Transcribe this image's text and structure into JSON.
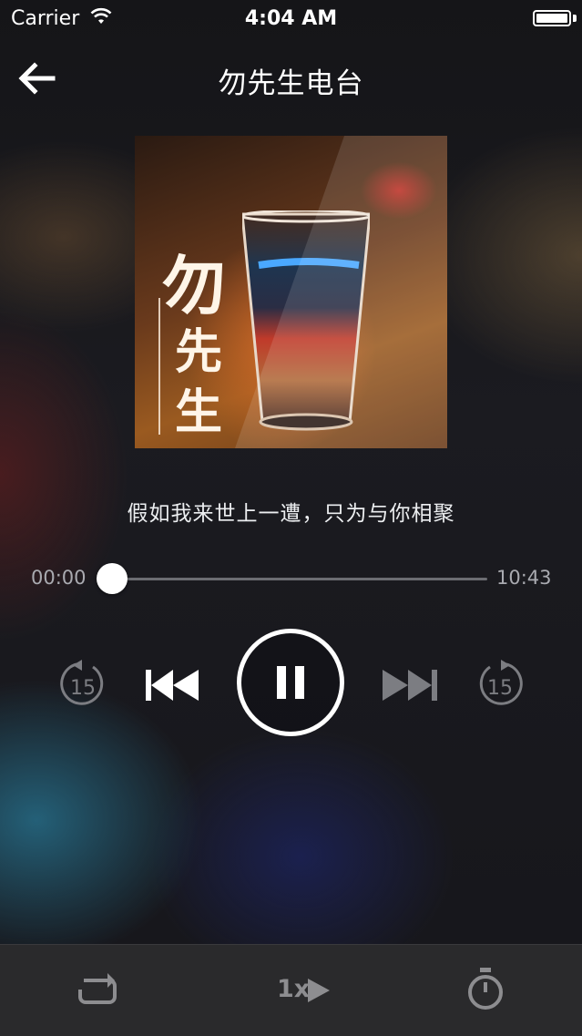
{
  "status_bar": {
    "carrier": "Carrier",
    "time": "4:04 AM"
  },
  "header": {
    "title": "勿先生电台"
  },
  "cover": {
    "char1": "勿",
    "char2": "先",
    "char3": "生"
  },
  "track": {
    "subtitle": "假如我来世上一遭，只为与你相聚"
  },
  "progress": {
    "current": "00:00",
    "total": "10:43",
    "fraction": 0.04
  },
  "controls": {
    "rewind_seconds": "15",
    "forward_seconds": "15",
    "state": "playing"
  },
  "bottom_bar": {
    "speed_label": "1x"
  },
  "icons": [
    "wifi-icon",
    "battery-icon",
    "back-arrow-icon",
    "rewind-15-icon",
    "previous-icon",
    "pause-icon",
    "next-icon",
    "forward-15-icon",
    "repeat-icon",
    "play-triangle-icon",
    "timer-icon"
  ]
}
